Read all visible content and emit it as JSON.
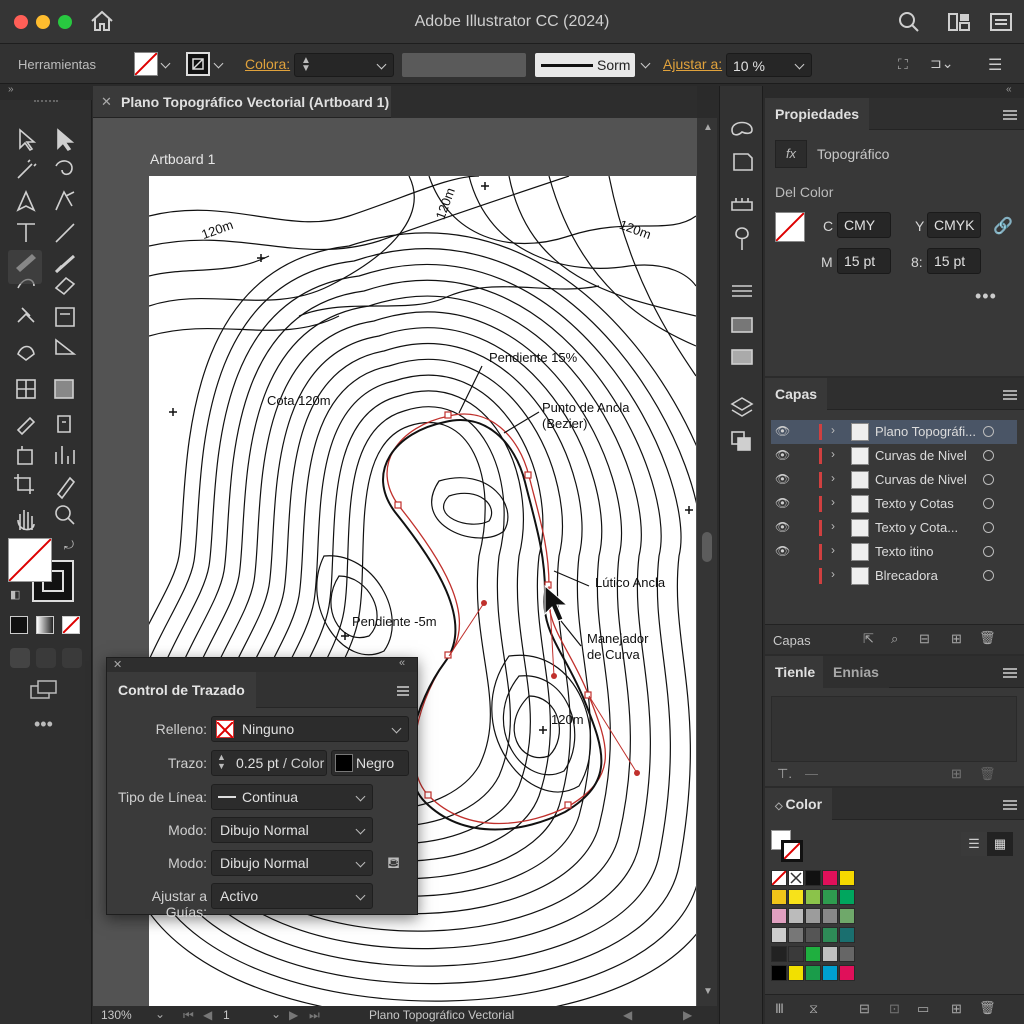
{
  "app": {
    "title": "Adobe Illustrator CC (2024)"
  },
  "control_bar": {
    "tools_label": "Herramientas",
    "color_label": "Colora:",
    "stroke_style": "Sorm",
    "align_label": "Ajustar a:",
    "align_value": "10 %"
  },
  "document": {
    "tab_title": "Plano Topográfico Vectorial (Artboard 1)",
    "artboard_label": "Artboard 1"
  },
  "map_labels": {
    "slope_top": "Pendiente 15%",
    "anchor_point": "Punto de Ancla",
    "anchor_point_sub": "(Bezier)",
    "cota": "Cota 120m",
    "ltico": "Lútico Ancla",
    "pend_mid": "Pendiente -5m",
    "handle": "Manejador",
    "handle_sub": "de Curva",
    "elev_a": "120m",
    "elev_b": "120m",
    "elev_c": "120m",
    "elev_d": "120m"
  },
  "properties": {
    "tab": "Propiedades",
    "fx_label": "Topográfico",
    "section": "Del Color",
    "c_label": "C",
    "c_value": "CMY",
    "y_label": "Y",
    "y_value": "CMYK",
    "m_label": "M",
    "m_value": "15 pt",
    "b_label": "8:",
    "b_value": "15 pt"
  },
  "layers": {
    "tab": "Capas",
    "footer": "Capas",
    "items": [
      {
        "name": "Plano Topográfi..."
      },
      {
        "name": "Curvas de Nivel"
      },
      {
        "name": "Curvas de Nivel"
      },
      {
        "name": "Texto y Cotas"
      },
      {
        "name": "Texto y Cota..."
      },
      {
        "name": "Texto itino"
      },
      {
        "name": "Blrecadora"
      }
    ]
  },
  "tiene_panel": {
    "tab1": "Tienle",
    "tab2": "Ennias"
  },
  "color_panel": {
    "tab": "Color",
    "swatches": [
      "#ffffff",
      "#ffffff",
      "#111111",
      "#e0105a",
      "#f5d800",
      "#f0c419",
      "#f7e21a",
      "#8bc34a",
      "#2e9c4f",
      "#00a65e",
      "#e1a0c0",
      "#bbbbbb",
      "#9c9c9c",
      "#888888",
      "#6fa86a",
      "#cccccc",
      "#777777",
      "#555555",
      "#2e8b57",
      "#1a6f6f",
      "#222222",
      "#3a3a3a",
      "#1faf3f",
      "#bfbfbf",
      "#666666",
      "#000000",
      "#f2e000",
      "#1a9c4a",
      "#00a0d0",
      "#e0105a"
    ]
  },
  "stroke_dialog": {
    "title": "Control de Trazado",
    "fill_label": "Relleno:",
    "fill_value": "Ninguno",
    "stroke_label": "Trazo:",
    "stroke_width": "0.25 pt",
    "stroke_color_label": "/ Color",
    "stroke_color": "Negro",
    "line_type_label": "Tipo de Línea:",
    "line_type": "Continua",
    "mode1_label": "Modo:",
    "mode1": "Dibujo Normal",
    "mode2_label": "Modo:",
    "mode2": "Dibujo Normal",
    "snap_label": "Ajustar a Guías:",
    "snap": "Activo"
  },
  "status": {
    "zoom": "130%",
    "page": "1",
    "doc_name": "Plano Topográfico Vectorial"
  }
}
